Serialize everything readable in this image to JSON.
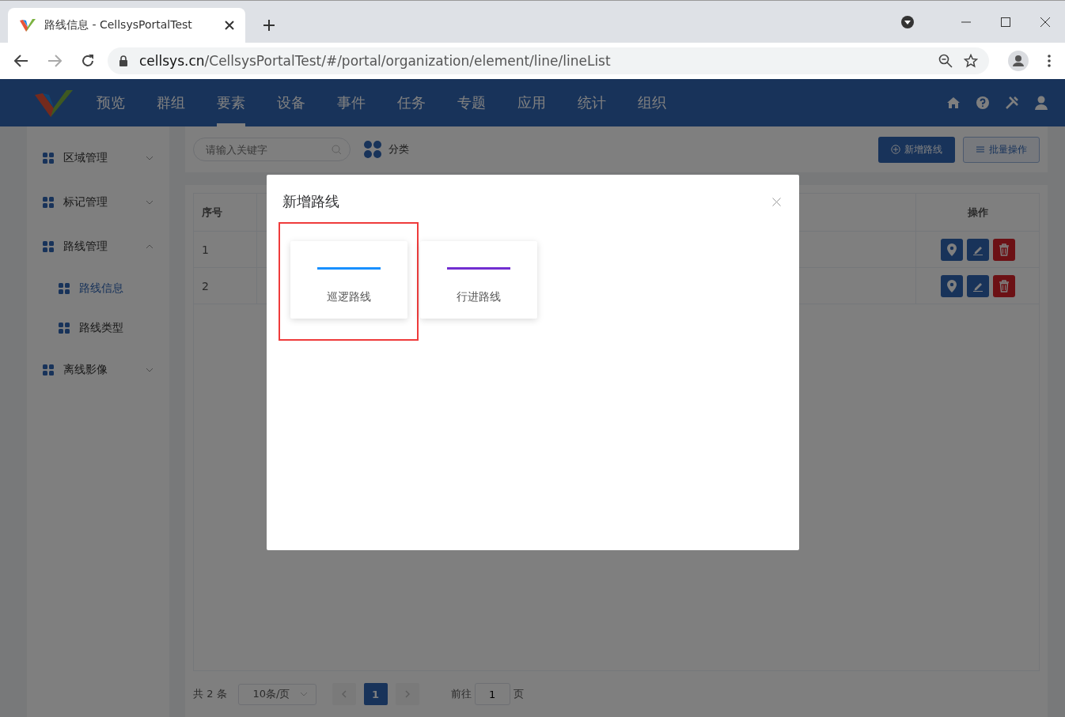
{
  "browser": {
    "tab_title": "路线信息 - CellsysPortalTest",
    "url_host": "cellsys.cn",
    "url_path": "/CellsysPortalTest/#/portal/organization/element/line/lineList"
  },
  "nav": [
    {
      "label": "预览",
      "selected": false
    },
    {
      "label": "群组",
      "selected": false
    },
    {
      "label": "要素",
      "selected": true
    },
    {
      "label": "设备",
      "selected": false
    },
    {
      "label": "事件",
      "selected": false
    },
    {
      "label": "任务",
      "selected": false
    },
    {
      "label": "专题",
      "selected": false
    },
    {
      "label": "应用",
      "selected": false
    },
    {
      "label": "统计",
      "selected": false
    },
    {
      "label": "组织",
      "selected": false
    }
  ],
  "sidebar": [
    {
      "label": "区域管理",
      "expanded": false
    },
    {
      "label": "标记管理",
      "expanded": false
    },
    {
      "label": "路线管理",
      "expanded": true,
      "children": [
        {
          "label": "路线信息",
          "selected": true
        },
        {
          "label": "路线类型",
          "selected": false
        }
      ]
    },
    {
      "label": "离线影像",
      "expanded": false
    }
  ],
  "toolbar": {
    "search_placeholder": "请输入关键字",
    "category": "分类",
    "buttons": [
      {
        "label": "新增路线",
        "kind": "primary"
      },
      {
        "label": "批量操作",
        "kind": "outline"
      }
    ]
  },
  "table": {
    "columns": [
      "序号",
      "操作"
    ],
    "rows": [
      {
        "index": "1"
      },
      {
        "index": "2"
      }
    ]
  },
  "pagination": {
    "total": "共 2 条",
    "page_size": "10条/页",
    "pages": [
      {
        "label": "1",
        "selected": true
      }
    ],
    "goto_label": "前往",
    "goto_value": "1",
    "page_suffix": "页"
  },
  "modal": {
    "title": "新增路线",
    "options": [
      {
        "label": "巡逻路线",
        "color": "#1890ff",
        "highlighted": true
      },
      {
        "label": "行进路线",
        "color": "#722ed1",
        "highlighted": false
      }
    ]
  }
}
